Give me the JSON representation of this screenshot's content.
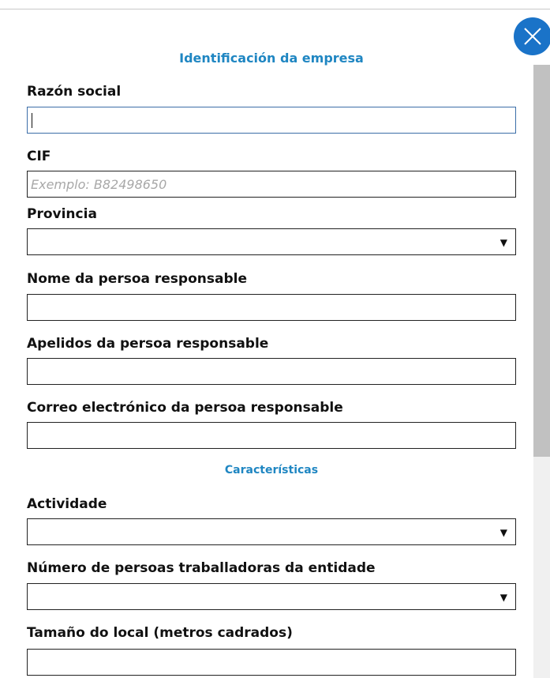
{
  "form": {
    "section_company": "Identificación da empresa",
    "section_characteristics": "Características",
    "fields": {
      "razon_social": {
        "label": "Razón social",
        "value": ""
      },
      "cif": {
        "label": "CIF",
        "placeholder": "Exemplo: B82498650",
        "value": ""
      },
      "provincia": {
        "label": "Provincia",
        "selected": ""
      },
      "nome": {
        "label": "Nome da persoa responsable",
        "value": ""
      },
      "apelidos": {
        "label": "Apelidos da persoa responsable",
        "value": ""
      },
      "correo": {
        "label": "Correo electrónico da persoa responsable",
        "value": ""
      },
      "actividade": {
        "label": "Actividade",
        "selected": ""
      },
      "numero_persoas": {
        "label": "Número de persoas traballadoras da entidade",
        "selected": ""
      },
      "tamano_local": {
        "label": "Tamaño do local (metros cadrados)",
        "value": ""
      }
    },
    "select_arrow_glyph": "▼"
  },
  "icons": {
    "close": "close-icon",
    "dropdown": "dropdown-arrow-icon"
  },
  "colors": {
    "accent": "#1f86c2",
    "close_button": "#1a73c8",
    "field_border": "#222222",
    "focused_border": "#3b6ea8"
  }
}
